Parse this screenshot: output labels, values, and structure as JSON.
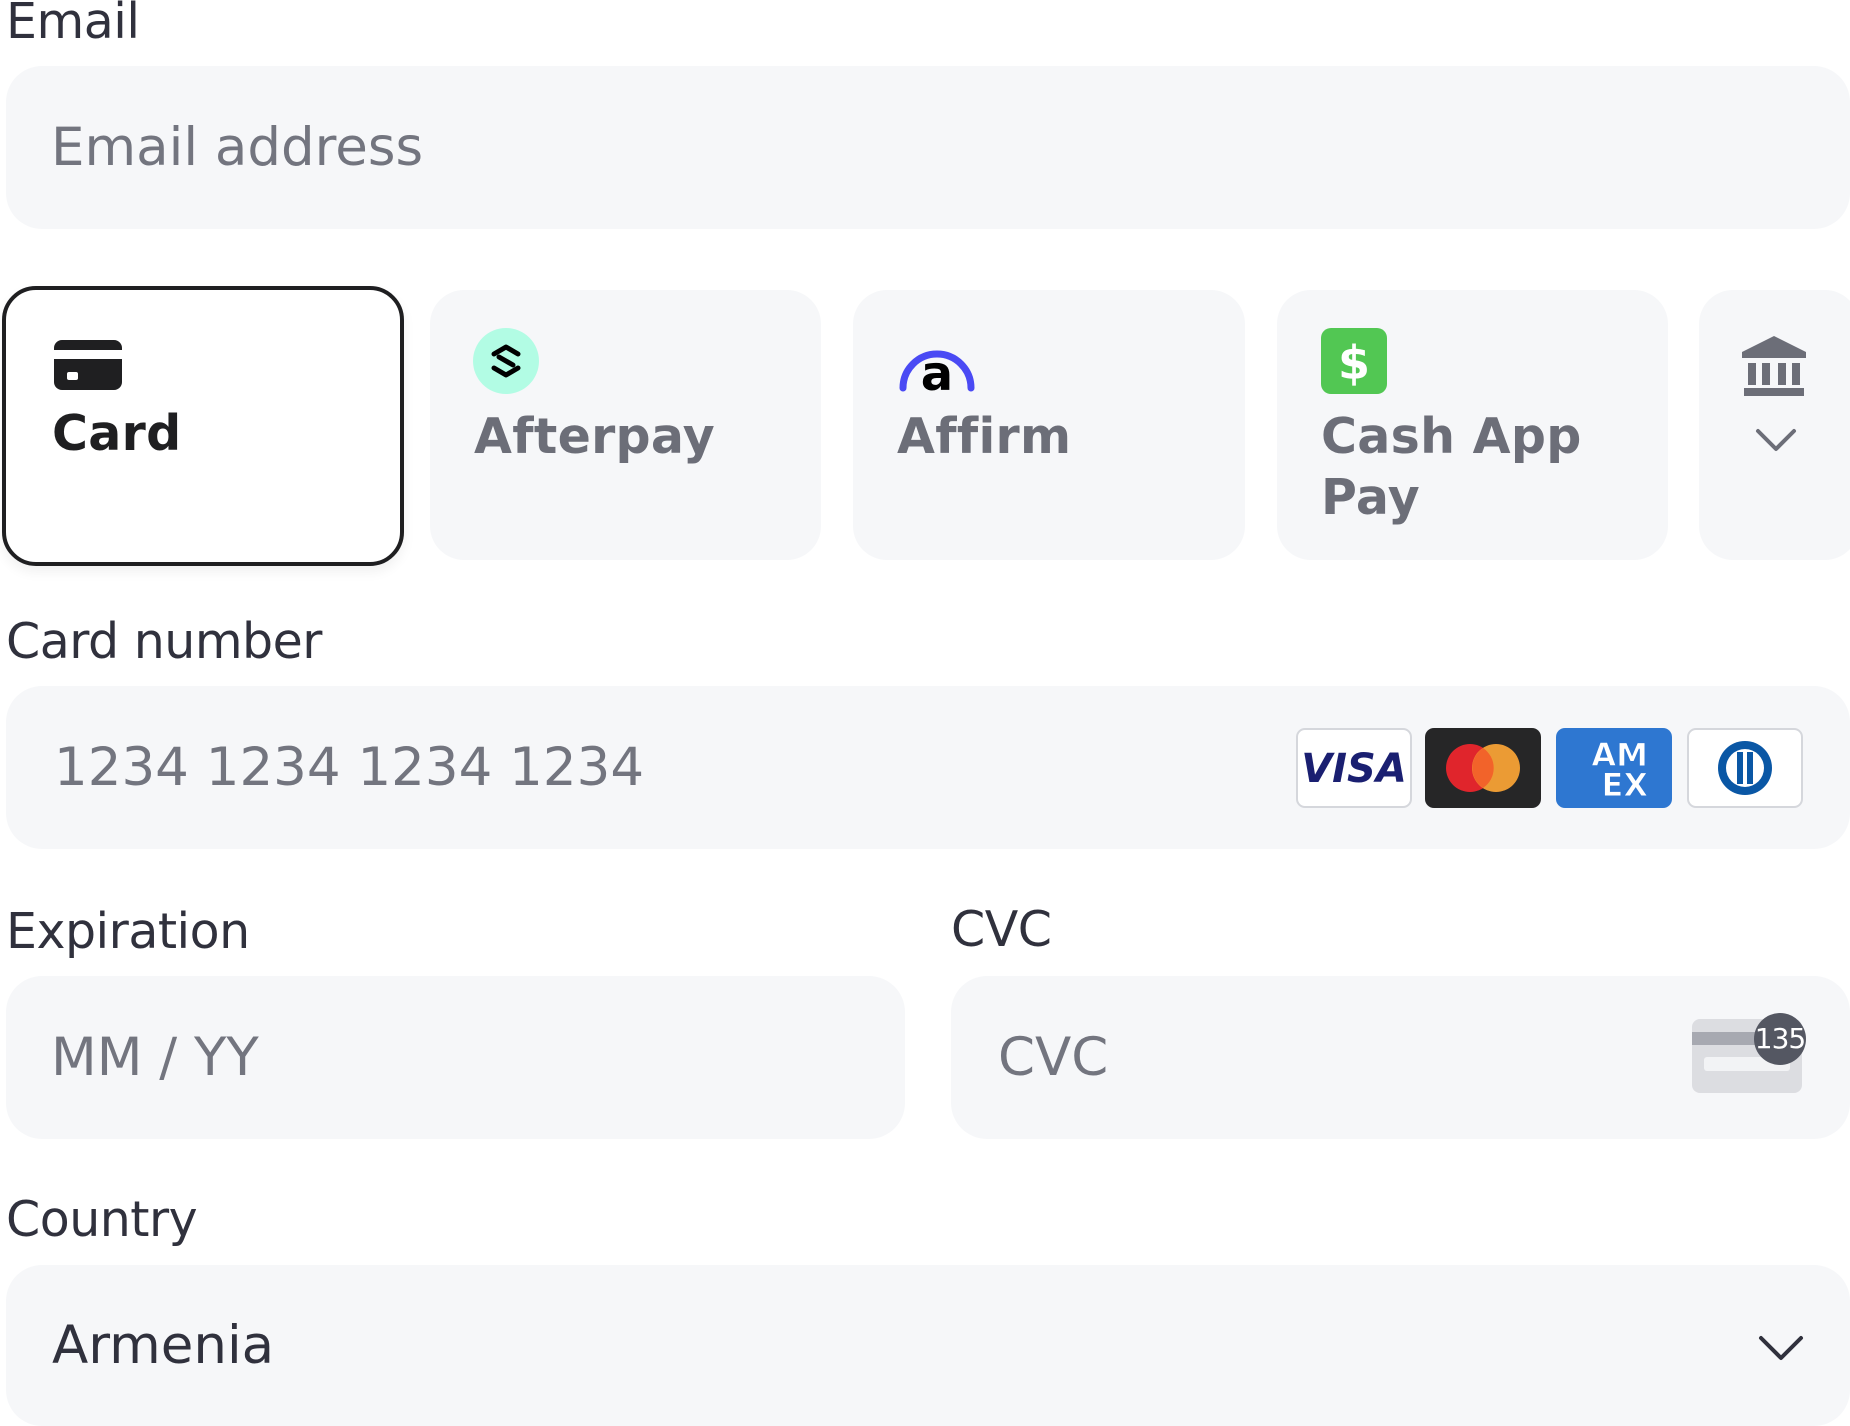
{
  "email": {
    "label": "Email",
    "placeholder": "Email address"
  },
  "payment_methods": [
    {
      "label": "Card",
      "icon": "card-icon",
      "selected": true
    },
    {
      "label": "Afterpay",
      "icon": "afterpay-icon",
      "selected": false
    },
    {
      "label": "Affirm",
      "icon": "affirm-icon",
      "selected": false
    },
    {
      "label": "Cash App Pay",
      "label_line1": "Cash App",
      "label_line2": "Pay",
      "icon": "cash-app-icon",
      "selected": false
    },
    {
      "label": "",
      "icon": "bank-icon",
      "selected": false
    }
  ],
  "card_number": {
    "label": "Card number",
    "placeholder": "1234 1234 1234 1234",
    "brands": [
      "VISA",
      "Mastercard",
      "AM EX",
      "Diners Club"
    ]
  },
  "expiration": {
    "label": "Expiration",
    "placeholder": "MM / YY"
  },
  "cvc": {
    "label": "CVC",
    "placeholder": "CVC",
    "hint_number": "135"
  },
  "country": {
    "label": "Country",
    "value": "Armenia"
  },
  "colors": {
    "field_bg": "#f6f7f9",
    "text": "#30313d",
    "placeholder": "#73757f",
    "cash_app_green": "#52c753",
    "afterpay_mint": "#b2fce4",
    "affirm_blue": "#4a4af4",
    "amex_blue": "#2e77d1",
    "visa_navy": "#1a1f71"
  }
}
